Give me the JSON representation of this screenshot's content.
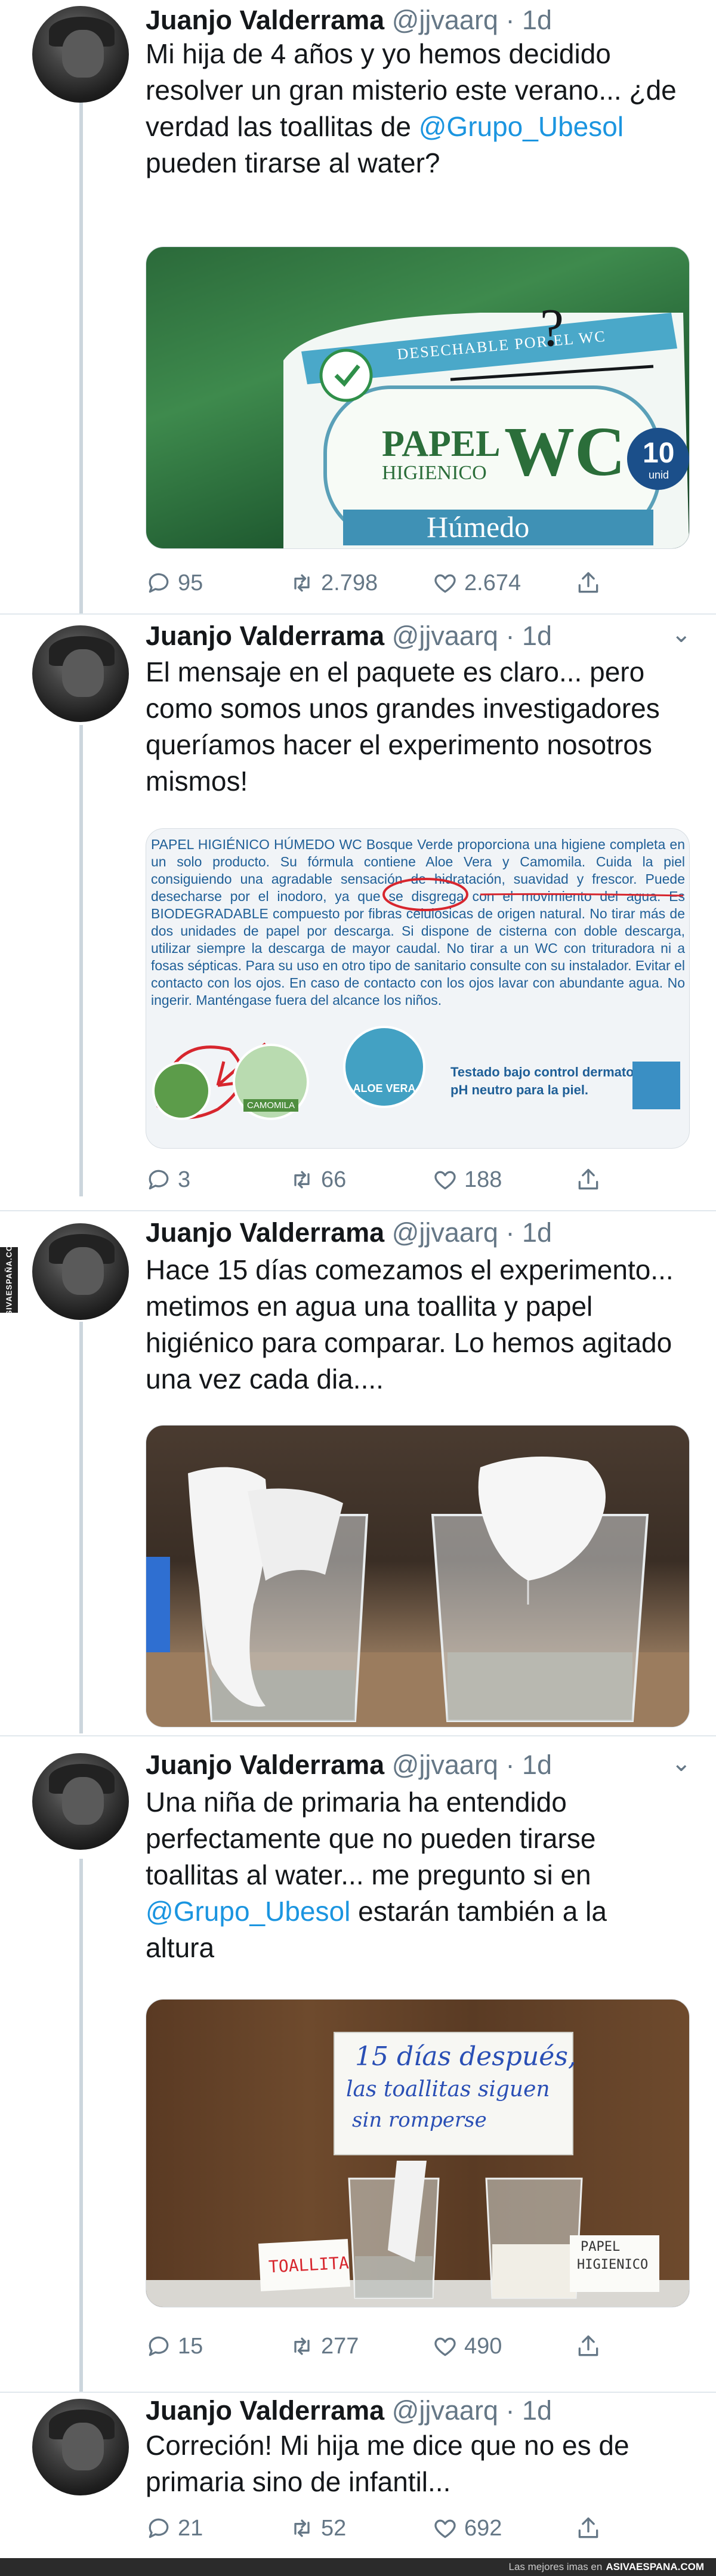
{
  "author": {
    "name": "Juanjo Valderrama",
    "handle": "@jjvaarq",
    "time": "· 1d"
  },
  "watermark": "ASIVAESPAÑA.COM",
  "tweets": [
    {
      "text_parts": [
        "Mi hija de 4 años y yo hemos decidido resolver un gran misterio este verano... ¿de verdad las toallitas de ",
        "@Grupo_Ubesol",
        " pueden tirarse al water?"
      ],
      "image": {
        "package_top_label": "DESECHABLE POR EL WC",
        "brand_line1": "PAPEL",
        "brand_line2": "HIGIENICO",
        "brand_wc": "WC",
        "product_word": "Húmedo",
        "count": "10",
        "count_unit": "unid"
      },
      "replies": "95",
      "retweets": "2.798",
      "likes": "2.674"
    },
    {
      "text_parts": [
        "El mensaje en el paquete es claro... pero como somos unos grandes investigadores queríamos hacer el experimento nosotros mismos!"
      ],
      "image": {
        "paragraph": "PAPEL HIGIÉNICO HÚMEDO WC Bosque Verde proporciona una higiene completa en un solo producto. Su fórmula contiene Aloe Vera y Camomila. Cuida la piel consiguiendo una agradable sensación de hidratación, suavidad y frescor. Puede desecharse por el inodoro, ya que se disgrega con el movimiento del agua. Es BIODEGRADABLE compuesto por fibras celulósicas de origen natural. No tirar más de dos unidades de papel por descarga. Si dispone de cisterna con doble descarga, utilizar siempre la descarga de mayor caudal. No tirar a un WC con trituradora ni a fosas sépticas. Para su uso en otro tipo de sanitario consulte con su instalador. Evitar el contacto con los ojos. En caso de contacto con los ojos lavar con abundante agua. No ingerir. Manténgase fuera del alcance los niños.",
        "badge1": "CAMOMILA",
        "badge2": "ALOE VERA",
        "tested1": "Testado bajo control dermatológico.",
        "tested2": "pH neutro para la piel."
      },
      "replies": "3",
      "retweets": "66",
      "likes": "188"
    },
    {
      "text_parts": [
        "Hace 15 días comezamos el experimento... metimos en agua una toallita y papel higiénico para comparar. Lo hemos agitado una vez cada dia...."
      ]
    },
    {
      "text_parts": [
        "Una niña de primaria ha entendido perfectamente que no pueden tirarse toallitas al water... me pregunto si en ",
        "@Grupo_Ubesol",
        " estarán también a la altura"
      ],
      "image": {
        "sign_line1": "15 días después,",
        "sign_line2": "las toallitas siguen",
        "sign_line3": "sin romperse",
        "label_left": "TOALLITA",
        "label_right_1": "PAPEL",
        "label_right_2": "HIGIENICO"
      },
      "replies": "15",
      "retweets": "277",
      "likes": "490"
    },
    {
      "text_parts": [
        "Correción! Mi hija me dice que no es de primaria sino de infantil..."
      ],
      "replies": "21",
      "retweets": "52",
      "likes": "692"
    }
  ],
  "footer": {
    "text": "Las mejores imas en",
    "site": "ASIVAESPANA.COM"
  }
}
